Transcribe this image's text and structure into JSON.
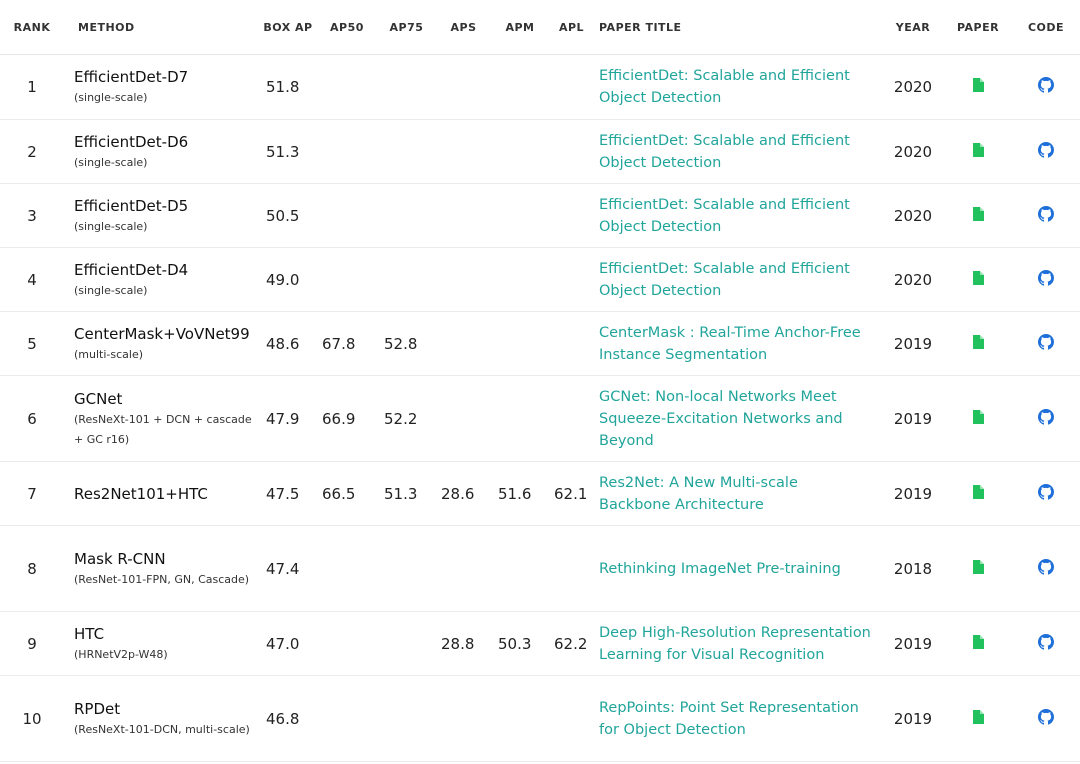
{
  "headers": {
    "rank": "RANK",
    "method": "METHOD",
    "box_ap": "BOX AP",
    "ap50": "AP50",
    "ap75": "AP75",
    "aps": "APS",
    "apm": "APM",
    "apl": "APL",
    "paper_title": "PAPER TITLE",
    "year": "YEAR",
    "paper": "PAPER",
    "code": "CODE"
  },
  "colors": {
    "paper_icon": "#21c25e",
    "code_icon": "#1e6fd9",
    "link": "#21a59b"
  },
  "icons": {
    "paper": "document-icon",
    "code": "github-icon"
  },
  "rows": [
    {
      "rank": "1",
      "method": "EfficientDet-D7",
      "detail": "(single-scale)",
      "box_ap": "51.8",
      "ap50": "",
      "ap75": "",
      "aps": "",
      "apm": "",
      "apl": "",
      "title": "EfficientDet: Scalable and Efficient Object Detection",
      "year": "2020"
    },
    {
      "rank": "2",
      "method": "EfficientDet-D6",
      "detail": "(single-scale)",
      "box_ap": "51.3",
      "ap50": "",
      "ap75": "",
      "aps": "",
      "apm": "",
      "apl": "",
      "title": "EfficientDet: Scalable and Efficient Object Detection",
      "year": "2020"
    },
    {
      "rank": "3",
      "method": "EfficientDet-D5",
      "detail": "(single-scale)",
      "box_ap": "50.5",
      "ap50": "",
      "ap75": "",
      "aps": "",
      "apm": "",
      "apl": "",
      "title": "EfficientDet: Scalable and Efficient Object Detection",
      "year": "2020"
    },
    {
      "rank": "4",
      "method": "EfficientDet-D4",
      "detail": "(single-scale)",
      "box_ap": "49.0",
      "ap50": "",
      "ap75": "",
      "aps": "",
      "apm": "",
      "apl": "",
      "title": "EfficientDet: Scalable and Efficient Object Detection",
      "year": "2020"
    },
    {
      "rank": "5",
      "method": "CenterMask+VoVNet99",
      "detail": "(multi-scale)",
      "box_ap": "48.6",
      "ap50": "67.8",
      "ap75": "52.8",
      "aps": "",
      "apm": "",
      "apl": "",
      "title": "CenterMask : Real-Time Anchor-Free Instance Segmentation",
      "year": "2019"
    },
    {
      "rank": "6",
      "method": "GCNet",
      "detail": "(ResNeXt-101 + DCN + cascade + GC r16)",
      "box_ap": "47.9",
      "ap50": "66.9",
      "ap75": "52.2",
      "aps": "",
      "apm": "",
      "apl": "",
      "title": "GCNet: Non-local Networks Meet Squeeze-Excitation Networks and Beyond",
      "year": "2019"
    },
    {
      "rank": "7",
      "method": "Res2Net101+HTC",
      "detail": "",
      "box_ap": "47.5",
      "ap50": "66.5",
      "ap75": "51.3",
      "aps": "28.6",
      "apm": "51.6",
      "apl": "62.1",
      "title": "Res2Net: A New Multi-scale Backbone Architecture",
      "year": "2019"
    },
    {
      "rank": "8",
      "method": "Mask R-CNN",
      "detail": "(ResNet-101-FPN, GN, Cascade)",
      "box_ap": "47.4",
      "ap50": "",
      "ap75": "",
      "aps": "",
      "apm": "",
      "apl": "",
      "title": "Rethinking ImageNet Pre-training",
      "year": "2018"
    },
    {
      "rank": "9",
      "method": "HTC",
      "detail": "(HRNetV2p-W48)",
      "box_ap": "47.0",
      "ap50": "",
      "ap75": "",
      "aps": "28.8",
      "apm": "50.3",
      "apl": "62.2",
      "title": "Deep High-Resolution Representation Learning for Visual Recognition",
      "year": "2019"
    },
    {
      "rank": "10",
      "method": "RPDet",
      "detail": "(ResNeXt-101-DCN, multi-scale)",
      "box_ap": "46.8",
      "ap50": "",
      "ap75": "",
      "aps": "",
      "apm": "",
      "apl": "",
      "title": "RepPoints: Point Set Representation for Object Detection",
      "year": "2019"
    }
  ]
}
